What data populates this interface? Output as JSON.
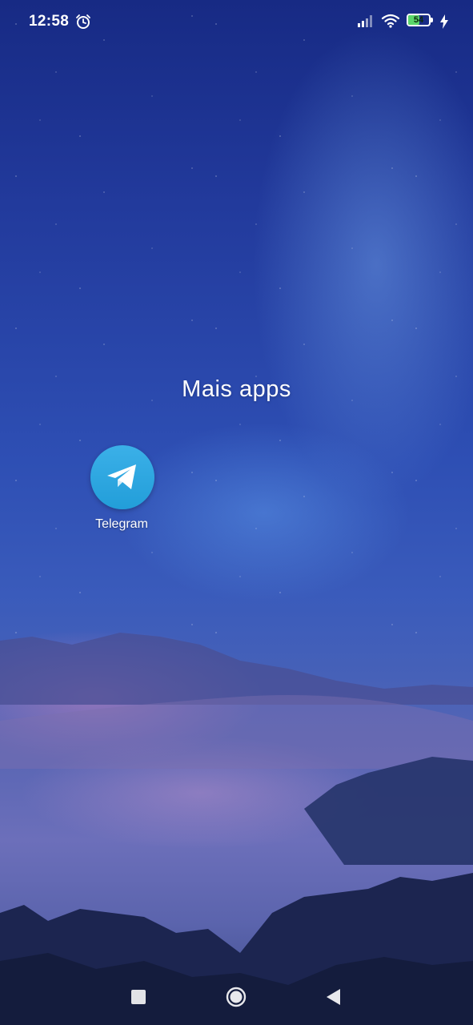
{
  "status_bar": {
    "time": "12:58",
    "alarm_icon": "alarm-clock-icon",
    "signal_icon": "cellular-signal-icon",
    "wifi_icon": "wifi-icon",
    "battery_level": "54",
    "battery_fraction": 0.54,
    "charging_icon": "lightning-bolt-icon",
    "battery_color": "#5ad66a"
  },
  "folder": {
    "title": "Mais apps"
  },
  "apps": [
    {
      "label": "Telegram",
      "icon": "telegram-paper-plane-icon",
      "color": "#229ed9"
    }
  ],
  "nav_bar": {
    "recents_icon": "square-recents-icon",
    "home_icon": "circle-home-icon",
    "back_icon": "triangle-back-icon"
  }
}
